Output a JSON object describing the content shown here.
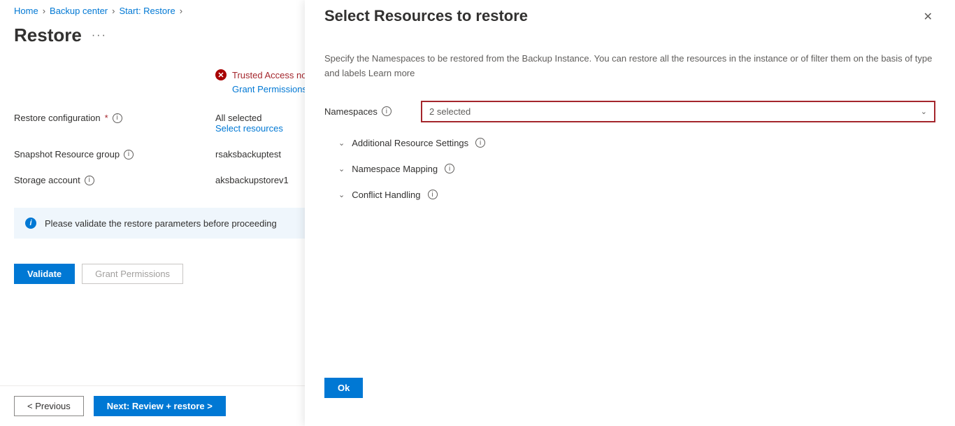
{
  "breadcrumb": {
    "home": "Home",
    "backup_center": "Backup center",
    "start_restore": "Start: Restore"
  },
  "page_title": "Restore",
  "error": {
    "line": "Trusted Access not enabled on the cluster. Click enable to proceed.",
    "link": "Grant Permissions"
  },
  "form": {
    "restore_config_label": "Restore configuration",
    "restore_config_value": "All selected",
    "select_resources_link": "Select resources",
    "snapshot_rg_label": "Snapshot Resource group",
    "snapshot_rg_value": "rsaksbackuptest",
    "storage_account_label": "Storage account",
    "storage_account_value": "aksbackupstorev1"
  },
  "info_bar": "Please validate the restore parameters before proceeding",
  "buttons": {
    "validate": "Validate",
    "grant": "Grant Permissions",
    "previous": "< Previous",
    "next": "Next: Review + restore >",
    "ok": "Ok"
  },
  "panel": {
    "title": "Select Resources to restore",
    "desc": "Specify the Namespaces to be restored from the Backup Instance. You can restore all the resources in the instance or of filter them on the basis of type and labels Learn more",
    "namespaces_label": "Namespaces",
    "namespaces_value": "2 selected",
    "expander1": "Additional Resource Settings",
    "expander2": "Namespace Mapping",
    "expander3": "Conflict Handling"
  }
}
